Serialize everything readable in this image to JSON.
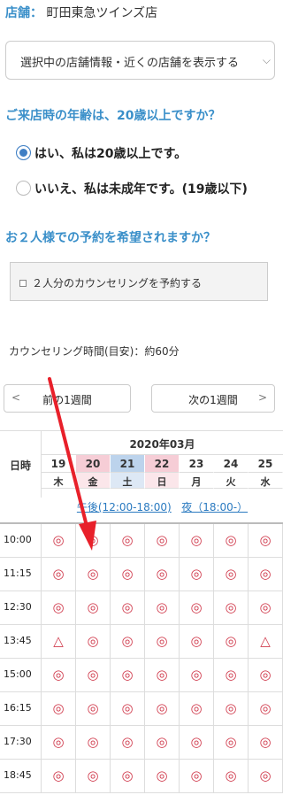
{
  "store": {
    "label": "店舗：",
    "name": "町田東急ツインズ店"
  },
  "store_select": {
    "text": "選択中の店舗情報・近くの店舗を表示する"
  },
  "age_question": {
    "title": "ご来店時の年齢は、20歳以上ですか？",
    "options": [
      {
        "label": "はい、私は20歳以上です。",
        "selected": true
      },
      {
        "label": "いいえ、私は未成年です。(19歳以下)",
        "selected": false
      }
    ]
  },
  "couple_question": {
    "title": "お２人様での予約を希望されますか？",
    "checkbox_label": "２人分のカウンセリングを予約する"
  },
  "duration": "カウンセリング時間(目安)：約60分",
  "nav": {
    "prev": "前の1週間",
    "next": "次の1週間"
  },
  "calendar": {
    "row_header": "日時",
    "month": "2020年03月",
    "days": [
      {
        "date": "19",
        "weekday": "木",
        "type": "weekday"
      },
      {
        "date": "20",
        "weekday": "金",
        "type": "holiday"
      },
      {
        "date": "21",
        "weekday": "土",
        "type": "saturday"
      },
      {
        "date": "22",
        "weekday": "日",
        "type": "sunday"
      },
      {
        "date": "23",
        "weekday": "月",
        "type": "weekday"
      },
      {
        "date": "24",
        "weekday": "火",
        "type": "weekday"
      },
      {
        "date": "25",
        "weekday": "水",
        "type": "weekday"
      }
    ],
    "period_day": "午後(12:00-18:00)",
    "period_night": "夜（18:00-）",
    "rows": [
      {
        "time": "10:00",
        "slots": [
          "◎",
          "◎",
          "◎",
          "◎",
          "◎",
          "◎",
          "◎"
        ]
      },
      {
        "time": "11:15",
        "slots": [
          "◎",
          "◎",
          "◎",
          "◎",
          "◎",
          "◎",
          "◎"
        ]
      },
      {
        "time": "12:30",
        "slots": [
          "◎",
          "◎",
          "◎",
          "◎",
          "◎",
          "◎",
          "◎"
        ]
      },
      {
        "time": "13:45",
        "slots": [
          "△",
          "◎",
          "◎",
          "◎",
          "◎",
          "◎",
          "△"
        ]
      },
      {
        "time": "15:00",
        "slots": [
          "◎",
          "◎",
          "◎",
          "◎",
          "◎",
          "◎",
          "◎"
        ]
      },
      {
        "time": "16:15",
        "slots": [
          "◎",
          "◎",
          "◎",
          "◎",
          "◎",
          "◎",
          "◎"
        ]
      },
      {
        "time": "17:30",
        "slots": [
          "◎",
          "◎",
          "◎",
          "◎",
          "◎",
          "◎",
          "◎"
        ]
      },
      {
        "time": "18:45",
        "slots": [
          "◎",
          "◎",
          "◎",
          "◎",
          "◎",
          "◎",
          "◎"
        ]
      }
    ]
  },
  "colors": {
    "accent": "#3a8fc9",
    "slot": "#d03a4c",
    "arrow": "#e8202a"
  }
}
